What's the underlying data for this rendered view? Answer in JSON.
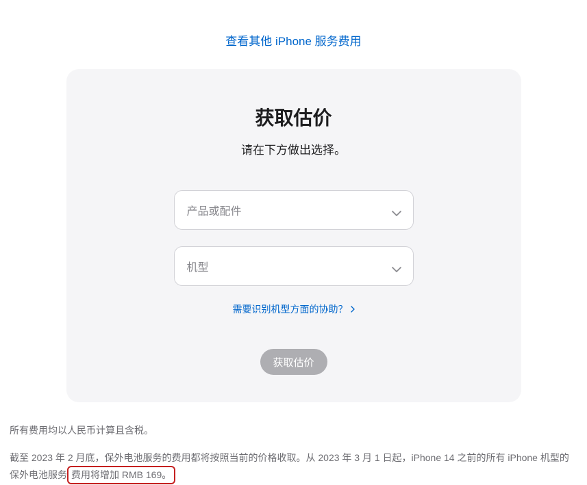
{
  "top_link": {
    "label": "查看其他 iPhone 服务费用"
  },
  "card": {
    "title": "获取估价",
    "subtitle": "请在下方做出选择。",
    "select1": {
      "placeholder": "产品或配件"
    },
    "select2": {
      "placeholder": "机型"
    },
    "help_link": {
      "label": "需要识别机型方面的协助？"
    },
    "cta": {
      "label": "获取估价"
    }
  },
  "footer": {
    "para1": "所有费用均以人民币计算且含税。",
    "para2_part1": "截至 2023 年 2 月底，保外电池服务的费用都将按照当前的价格收取。从 2023 年 3 月 1 日起，iPhone 14 之前的所有 iPhone 机型的保外电池服务",
    "para2_highlight": "费用将增加 RMB 169。"
  }
}
